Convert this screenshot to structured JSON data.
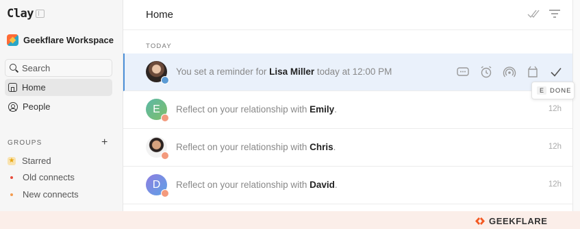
{
  "app": {
    "logo": "Clay"
  },
  "sidebar": {
    "workspace_name": "Geekflare Workspace",
    "search_label": "Search",
    "nav": [
      {
        "label": "Home",
        "active": true,
        "icon": "home-icon"
      },
      {
        "label": "People",
        "active": false,
        "icon": "people-icon"
      }
    ],
    "groups_label": "GROUPS",
    "groups": [
      {
        "label": "Starred",
        "icon": "star-icon",
        "color": "#e9a712"
      },
      {
        "label": "Old connects",
        "icon": "dot-icon",
        "color": "#e74c3c"
      },
      {
        "label": "New connects",
        "icon": "dot-icon",
        "color": "#f39c50"
      }
    ]
  },
  "main": {
    "title": "Home",
    "section_label": "TODAY",
    "rows": [
      {
        "prefix": "You set a reminder for ",
        "name": "Lisa Miller",
        "suffix": " today at 12:00 PM",
        "time": "",
        "selected": true,
        "avatar_letter": ""
      },
      {
        "prefix": "Reflect on your relationship with ",
        "name": "Emily",
        "suffix": ".",
        "time": "12h",
        "avatar_letter": "E"
      },
      {
        "prefix": "Reflect on your relationship with ",
        "name": "Chris",
        "suffix": ".",
        "time": "12h",
        "avatar_letter": ""
      },
      {
        "prefix": "Reflect on your relationship with ",
        "name": "David",
        "suffix": ".",
        "time": "12h",
        "avatar_letter": "D"
      }
    ],
    "tooltip": {
      "key": "E",
      "label": "DONE"
    }
  },
  "footer": {
    "brand": "GEEKFLARE"
  },
  "colors": {
    "selected_row": "#eaf1fb",
    "accent": "#4a8fd8",
    "brand": "#f35a24"
  }
}
